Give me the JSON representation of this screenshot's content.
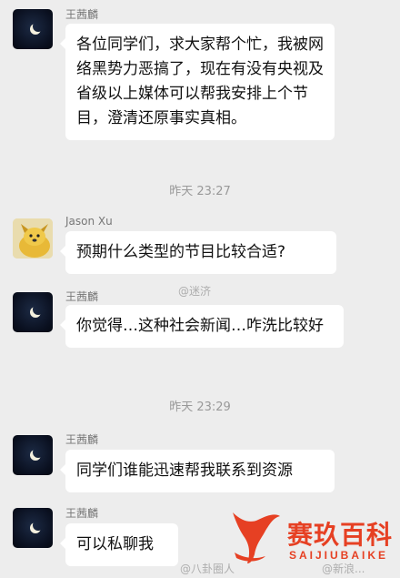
{
  "messages": [
    {
      "sender": "王茜麟",
      "avatar": "moon-night-avatar",
      "text": "各位同学们，求大家帮个忙，我被网络黑势力恶搞了，现在有没有央视及省级以上媒体可以帮我安排上个节目，澄清还原事实真相。"
    },
    {
      "sender": "Jason Xu",
      "avatar": "yellow-dog-avatar",
      "text": "预期什么类型的节目比较合适?"
    },
    {
      "sender": "王茜麟",
      "avatar": "moon-night-avatar",
      "text": "你觉得…这种社会新闻…咋洗比较好"
    },
    {
      "sender": "王茜麟",
      "avatar": "moon-night-avatar",
      "text": "同学们谁能迅速帮我联系到资源"
    },
    {
      "sender": "王茜麟",
      "avatar": "moon-night-avatar",
      "text": "可以私聊我"
    }
  ],
  "timestamps": [
    "昨天 23:27",
    "昨天 23:29"
  ],
  "watermarks": {
    "weibo_mid": "@迷济",
    "weibo_bottom_left": "@八卦圈人",
    "weibo_bottom_right": "@新浪..."
  },
  "logo": {
    "cn": "赛玖百科",
    "en": "SAIJIUBAIKE",
    "color": "#e64023"
  },
  "colors": {
    "background": "#ededed",
    "bubble": "#ffffff",
    "name_text": "#777777",
    "time_text": "#999999"
  }
}
